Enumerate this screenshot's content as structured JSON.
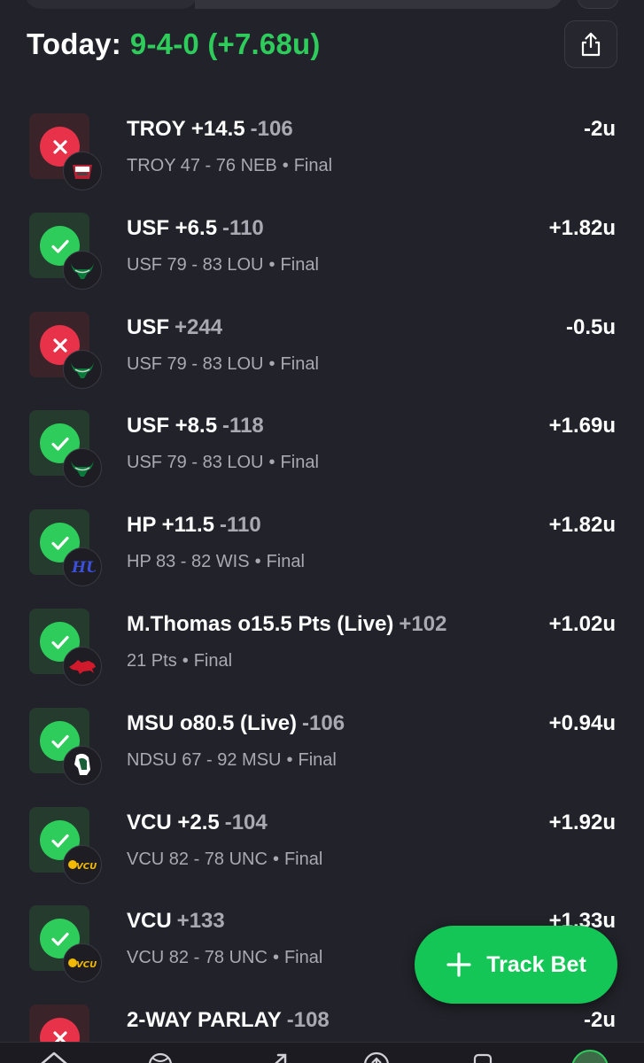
{
  "header": {
    "label": "Today:",
    "record": "9-4-0 (+7.68u)"
  },
  "colors": {
    "win": "#2ecc5b",
    "loss": "#e8324a",
    "background": "#22222a",
    "accent": "#14c655"
  },
  "bets": [
    {
      "status": "loss",
      "pick": "TROY +14.5",
      "odds": "-106",
      "score": "TROY 47 - 76 NEB",
      "state": "Final",
      "result": "-2u",
      "logo": "troy-logo-icon"
    },
    {
      "status": "win",
      "pick": "USF +6.5",
      "odds": "-110",
      "score": "USF 79 - 83 LOU",
      "state": "Final",
      "result": "+1.82u",
      "logo": "usf-bull-logo-icon"
    },
    {
      "status": "loss",
      "pick": "USF",
      "odds": "+244",
      "score": "USF 79 - 83 LOU",
      "state": "Final",
      "result": "-0.5u",
      "logo": "usf-bull-logo-icon"
    },
    {
      "status": "win",
      "pick": "USF +8.5",
      "odds": "-118",
      "score": "USF 79 - 83 LOU",
      "state": "Final",
      "result": "+1.69u",
      "logo": "usf-bull-logo-icon"
    },
    {
      "status": "win",
      "pick": "HP +11.5",
      "odds": "-110",
      "score": "HP 83 - 82 WIS",
      "state": "Final",
      "result": "+1.82u",
      "logo": "high-point-logo-icon"
    },
    {
      "status": "win",
      "pick": "M.Thomas o15.5 Pts (Live)",
      "odds": "+102",
      "score": "21 Pts",
      "state": "Final",
      "result": "+1.02u",
      "logo": "razorback-logo-icon"
    },
    {
      "status": "win",
      "pick": "MSU o80.5 (Live)",
      "odds": "-106",
      "score": "NDSU 67 - 92 MSU",
      "state": "Final",
      "result": "+0.94u",
      "logo": "spartan-logo-icon"
    },
    {
      "status": "win",
      "pick": "VCU +2.5",
      "odds": "-104",
      "score": "VCU 82 - 78 UNC",
      "state": "Final",
      "result": "+1.92u",
      "logo": "vcu-logo-icon"
    },
    {
      "status": "win",
      "pick": "VCU",
      "odds": "+133",
      "score": "VCU 82 - 78 UNC",
      "state": "Final",
      "result": "+1.33u",
      "logo": "vcu-logo-icon"
    },
    {
      "status": "loss",
      "pick": "2-WAY PARLAY",
      "odds": "-108",
      "score": "",
      "state": "",
      "result": "-2u",
      "logo": "parlay-logo-icon"
    }
  ],
  "track_bet": {
    "label": "Track Bet"
  },
  "nav": {
    "icons": [
      "home-icon",
      "basketball-icon",
      "trend-icon",
      "upload-icon",
      "cards-icon",
      "profile-avatar"
    ]
  }
}
